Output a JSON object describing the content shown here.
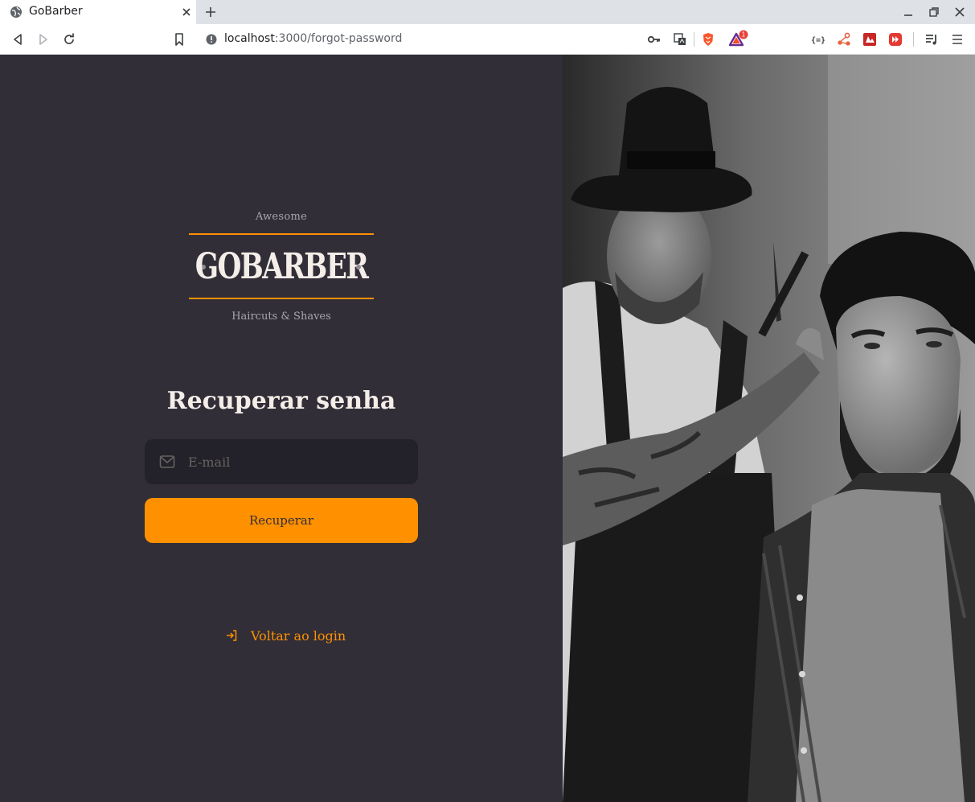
{
  "browser": {
    "tab_title": "GoBarber",
    "url_host": "localhost",
    "url_rest": ":3000/forgot-password",
    "extension_badge_count": "1"
  },
  "logo": {
    "top_text": "Awesome",
    "wordmark": "GOBARBER",
    "bottom_text": "Haircuts & Shaves"
  },
  "form": {
    "title": "Recuperar senha",
    "email_placeholder": "E-mail",
    "email_value": "",
    "submit_label": "Recuperar"
  },
  "back_link": {
    "label": "Voltar ao login"
  },
  "colors": {
    "background": "#312e38",
    "input_background": "#232129",
    "accent": "#ff9000",
    "text": "#f4ede8",
    "muted": "#666360"
  },
  "icons": {
    "email_field": "mail-icon",
    "back_link": "log-in-icon",
    "hero": "barber-photo"
  }
}
